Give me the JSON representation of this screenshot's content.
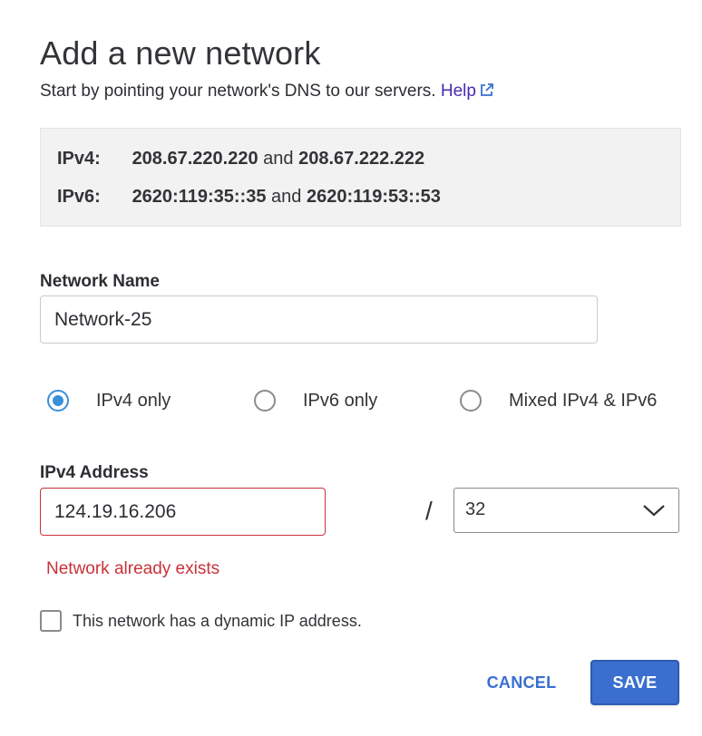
{
  "dialog": {
    "title": "Add a new network",
    "subtitle": "Start by pointing your network's DNS to our servers.",
    "help_link": "Help",
    "help_icon": "external-link-icon"
  },
  "dns": {
    "ipv4": {
      "label": "IPv4:",
      "primary": "208.67.220.220",
      "conj": "and",
      "secondary": "208.67.222.222"
    },
    "ipv6": {
      "label": "IPv6:",
      "primary": "2620:119:35::35",
      "conj": "and",
      "secondary": "2620:119:53::53"
    }
  },
  "network_name": {
    "label": "Network Name",
    "value": "Network-25"
  },
  "ip_version": {
    "options": [
      "IPv4 only",
      "IPv6 only",
      "Mixed IPv4 & IPv6"
    ],
    "selected": "IPv4 only"
  },
  "ipv4_address": {
    "label": "IPv4 Address",
    "value": "124.19.16.206",
    "separator": "/",
    "prefix": "32",
    "error": "Network already exists"
  },
  "dynamic_ip": {
    "label": "This network has a dynamic IP address.",
    "checked": false
  },
  "actions": {
    "cancel": "CANCEL",
    "save": "SAVE"
  },
  "colors": {
    "accent": "#3a6fd0",
    "error": "#c8323a",
    "radio_selected": "#3b8fd9",
    "help_link": "#4a2bb0"
  }
}
